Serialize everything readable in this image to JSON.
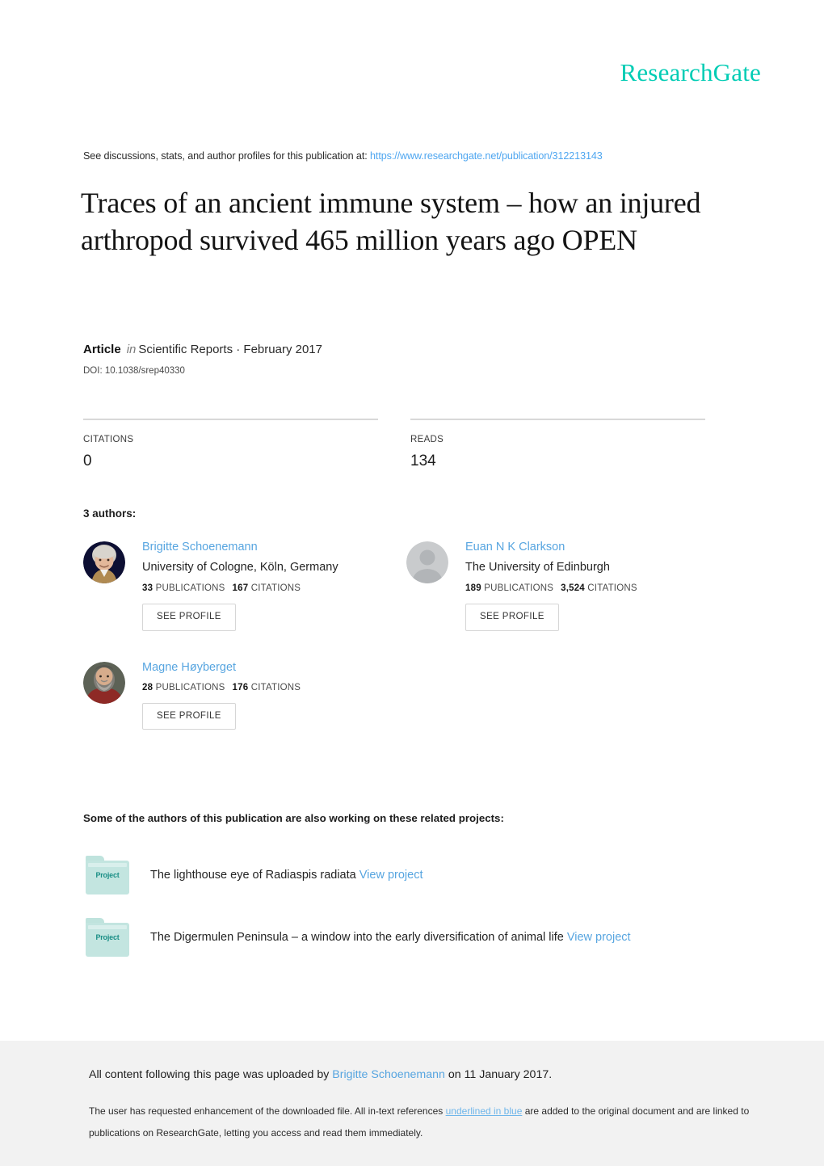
{
  "brand": {
    "logo_text": "ResearchGate",
    "logo_color": "#00ccb4"
  },
  "discussion": {
    "prefix": "See discussions, stats, and author profiles for this publication at:",
    "url": "https://www.researchgate.net/publication/312213143",
    "url_color": "#4ea6f0"
  },
  "publication": {
    "title": "Traces of an ancient immune system – how an injured arthropod survived 465 million years ago OPEN",
    "kind": "Article",
    "in_word": "in",
    "source": "Scientific Reports · February 2017",
    "doi": "DOI: 10.1038/srep40330"
  },
  "stats": [
    {
      "label": "CITATIONS",
      "value": "0"
    },
    {
      "label": "READS",
      "value": "134"
    }
  ],
  "authors_section": {
    "heading": "3 authors:",
    "see_profile_label": "SEE PROFILE",
    "publications_word": "PUBLICATIONS",
    "citations_word": "CITATIONS",
    "authors": [
      {
        "name": "Brigitte Schoenemann",
        "affiliation": "University of Cologne, Köln, Germany",
        "publications": "33",
        "citations": "167",
        "avatar": "photo-woman-white-hair"
      },
      {
        "name": "Euan N K Clarkson",
        "affiliation": "The University of Edinburgh",
        "publications": "189",
        "citations": "3,524",
        "avatar": "default-person-placeholder"
      },
      {
        "name": "Magne Høyberget",
        "affiliation": "",
        "publications": "28",
        "citations": "176",
        "avatar": "photo-bearded-man"
      }
    ]
  },
  "projects_section": {
    "heading": "Some of the authors of this publication are also working on these related projects:",
    "folder_label": "Project",
    "view_label": "View project",
    "projects": [
      {
        "title": "The lighthouse eye of Radiaspis radiata"
      },
      {
        "title": "The Digermulen Peninsula – a window into the early diversification of animal life"
      }
    ]
  },
  "footer": {
    "upload_prefix": "All content following this page was uploaded by",
    "uploader": "Brigitte Schoenemann",
    "upload_suffix": "on 11 January 2017.",
    "note_part1": "The user has requested enhancement of the downloaded file. All in-text references",
    "note_link": "underlined in blue",
    "note_part2": "are added to the original document and are linked to publications on ResearchGate, letting you access and read them immediately."
  }
}
